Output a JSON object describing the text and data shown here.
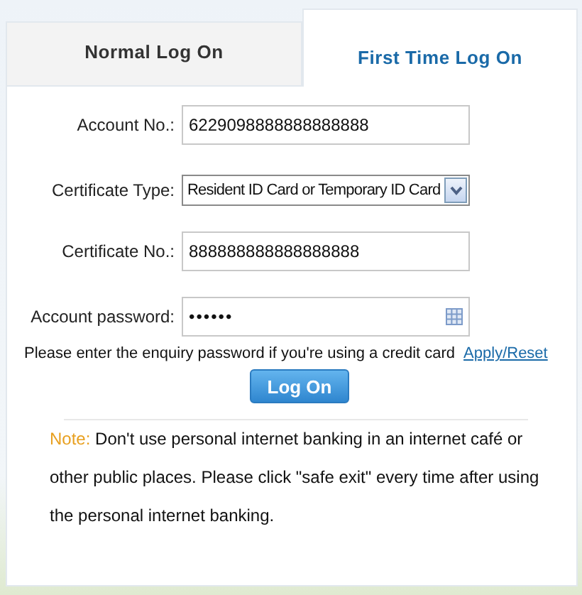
{
  "tabs": [
    {
      "label": "Normal Log On",
      "selected": false
    },
    {
      "label": "First Time Log On",
      "selected": true
    }
  ],
  "fields": [
    {
      "kind": "text",
      "label": "Account No.:",
      "value": "6229098888888888888"
    },
    {
      "kind": "select",
      "label": "Certificate Type:",
      "value": "Resident ID Card or Temporary ID Card"
    },
    {
      "kind": "text",
      "label": "Certificate No.:",
      "value": "888888888888888888"
    },
    {
      "kind": "password",
      "label": "Account password:",
      "value": "••••••"
    }
  ],
  "hint": {
    "text": "Please enter the enquiry password if you're using a credit card",
    "link": "Apply/Reset"
  },
  "submit": "Log On",
  "note": {
    "label": "Note:",
    "text": "Don't use personal internet banking in an internet café or other public places. Please click \"safe exit\" every time after using the personal internet banking."
  }
}
